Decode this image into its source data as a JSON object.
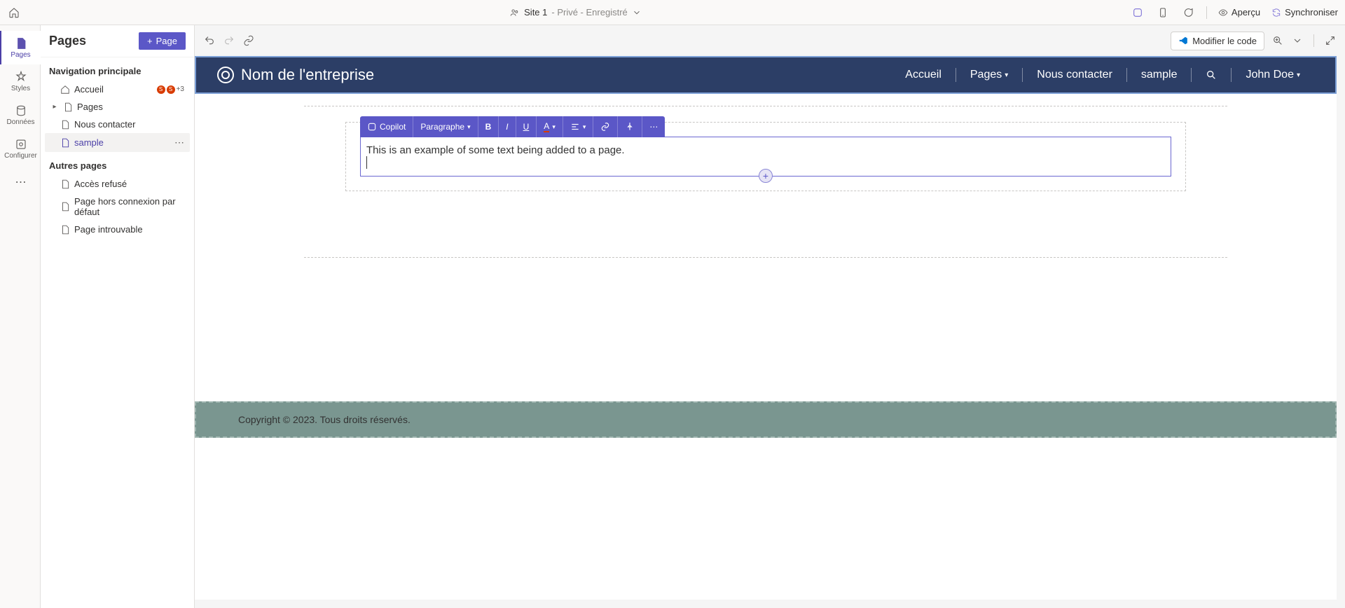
{
  "topbar": {
    "site_label": "Site 1",
    "site_status": " - Privé - Enregistré",
    "preview_label": "Aperçu",
    "sync_label": "Synchroniser"
  },
  "rail": {
    "pages": "Pages",
    "styles": "Styles",
    "data": "Données",
    "configure": "Configurer"
  },
  "side": {
    "title": "Pages",
    "add_button": "Page",
    "main_nav_title": "Navigation principale",
    "other_title": "Autres pages",
    "home": "Accueil",
    "home_badge_extra": "+3",
    "pages_item": "Pages",
    "contact": "Nous contacter",
    "sample": "sample",
    "access_denied": "Accès refusé",
    "offline": "Page hors connexion par défaut",
    "not_found": "Page introuvable"
  },
  "canvas": {
    "edit_code": "Modifier le code"
  },
  "editor_toolbar": {
    "copilot": "Copilot",
    "paragraph": "Paragraphe"
  },
  "preview": {
    "company": "Nom de l'entreprise",
    "nav": {
      "home": "Accueil",
      "pages": "Pages",
      "contact": "Nous contacter",
      "sample": "sample",
      "user": "John Doe"
    },
    "example_text": "This is an example of some text being added to a page.",
    "footer": "Copyright © 2023. Tous droits réservés."
  }
}
